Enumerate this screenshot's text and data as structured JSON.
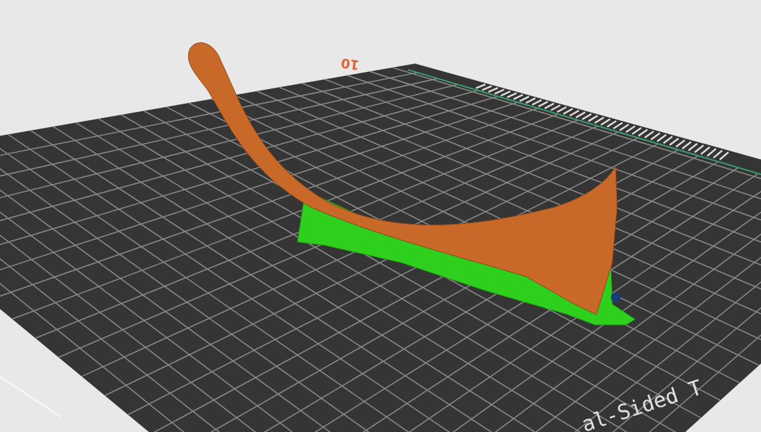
{
  "viewport": {
    "bed_number": "10",
    "bed_label": "al-Sided T"
  }
}
